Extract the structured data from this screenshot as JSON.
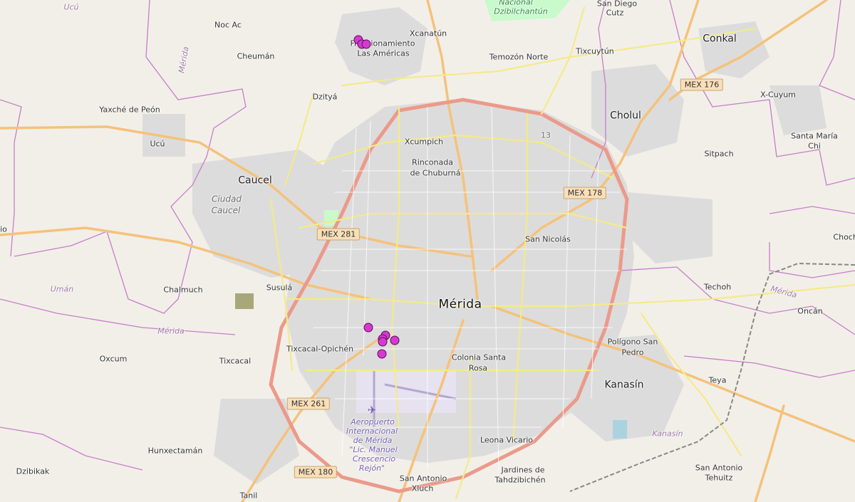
{
  "map": {
    "labels": {
      "merida": "Mérida",
      "caucel": "Caucel",
      "kanasin": "Kanasín",
      "cholul": "Cholul",
      "conkal": "Conkal",
      "noc_ac": "Noc Ac",
      "cheuman": "Cheumán",
      "dzitya": "Dzityá",
      "yaxche": "Yaxché de Peón",
      "ucu": "Ucú",
      "xcanatun": "Xcanatún",
      "temozon": "Temozón Norte",
      "tixcuytun": "Tixcuytún",
      "san_diego_cutz_1": "San Diego",
      "san_diego_cutz_2": "Cutz",
      "xcumpich": "Xcumpich",
      "rinconada_1": "Rinconada",
      "rinconada_2": "de Chuburná",
      "fracc_1": "Fraccionamiento",
      "fracc_2": "Las Américas",
      "san_nicolas": "San Nicolás",
      "chalmuch": "Chalmuch",
      "susula": "Susulá",
      "tixcacal_opichen": "Tixcacal-Opichén",
      "tixcacal": "Tixcacal",
      "oxcum": "Oxcum",
      "colonia_1": "Colonia Santa",
      "colonia_2": "Rosa",
      "poligono_1": "Polígono San",
      "poligono_2": "Pedro",
      "techoh": "Techoh",
      "oncan": "Oncán",
      "teya": "Teya",
      "leona_vicario": "Leona Vicario",
      "jardines_1": "Jardines de",
      "jardines_2": "Tahdzibichén",
      "san_antonio_xluch_1": "San Antonio",
      "san_antonio_xluch_2": "Xluch",
      "san_antonio_tehuitz_1": "San Antonio",
      "san_antonio_tehuitz_2": "Tehuitz",
      "hunxectaman": "Hunxectamán",
      "dzibikak": "Dzibikak",
      "tanil": "Tanil",
      "sitpach": "Sitpach",
      "santa_maria_1": "Santa María",
      "santa_maria_2": "Chi",
      "x_cuyum": "X-Cuyum",
      "chocho": "Chocho",
      "ucu_region": "Ucú",
      "merida_admin_1": "Mérida",
      "merida_admin_2": "Mérida",
      "merida_admin_3": "Mérida",
      "uman": "Umán",
      "kanasin_admin": "Kanasín",
      "ciudad_caucel_1": "Ciudad",
      "ciudad_caucel_2": "Caucel",
      "park_1": "Nacional",
      "park_2": "Dzibilchantún",
      "ring_road": "13",
      "left_edge": "io",
      "airport_1": "Aeropuerto",
      "airport_2": "Internacional",
      "airport_3": "de Mérida",
      "airport_4": "\"Lic. Manuel",
      "airport_5": "Crescencio",
      "airport_6": "Rejón\""
    },
    "highway_shields": {
      "mex176": "MEX 176",
      "mex178": "MEX 178",
      "mex281": "MEX 281",
      "mex261": "MEX 261",
      "mex180": "MEX 180"
    },
    "colors": {
      "background": "#f2efe9",
      "urban": "#dddddd",
      "major_road": "#fcd6a4",
      "primary_road": "#f7fabf",
      "motorway": "#e892a2",
      "admin_boundary": "#c77dc9",
      "marker_fill": "#d43ad0",
      "marker_stroke": "#5a0f58",
      "park": "#c8facc"
    },
    "icons": {
      "airport": "airplane-icon"
    },
    "marker_count": 9
  }
}
